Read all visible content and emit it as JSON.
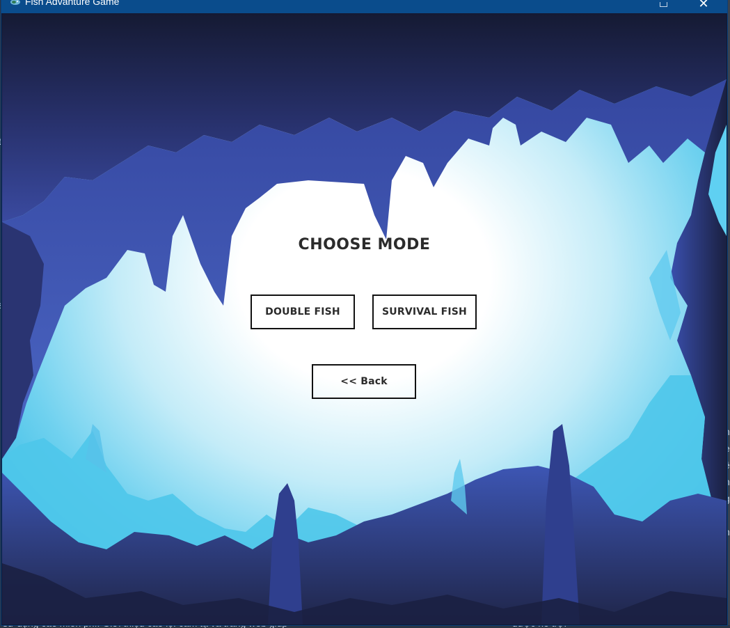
{
  "window": {
    "title": "Fish Advanture Game",
    "close_glyph": "✕"
  },
  "game": {
    "heading": "CHOOSE MODE",
    "buttons": {
      "double_fish": "DOUBLE FISH",
      "survival_fish": "SURVIVAL FISH",
      "back": "<< Back"
    }
  },
  "desktop_background": {
    "left_fragments": [
      "t",
      "s"
    ],
    "bottom_text": "sử dụng cao miễn phí. Giới thiệu cao lộ: cảm tạ và trang web giúp",
    "bottom_right_text": "được hỗ trợ.",
    "right_fragments": [
      "n",
      "e",
      "ề",
      "n",
      "g",
      "i",
      "n"
    ]
  },
  "colors": {
    "titlebar": "#0a4c8c",
    "button_border": "#111111",
    "text_dark": "#2b2b2b"
  }
}
